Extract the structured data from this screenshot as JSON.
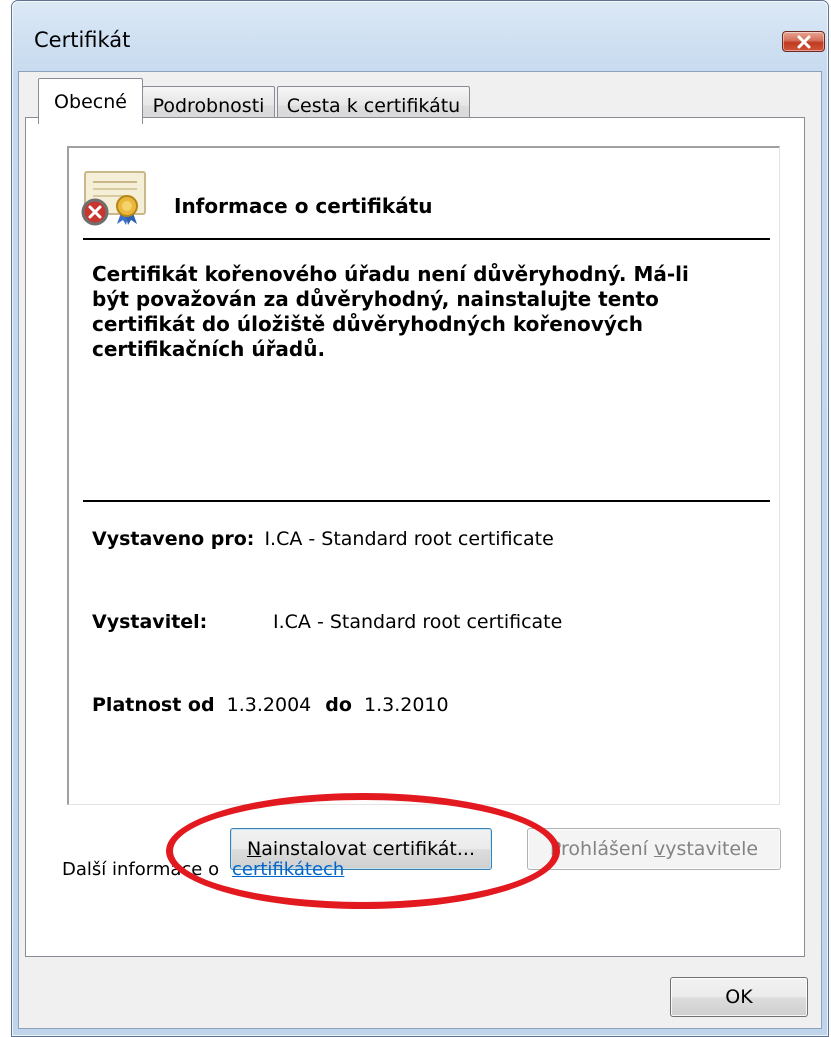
{
  "window": {
    "title": "Certifikát"
  },
  "tabs": [
    {
      "label": "Obecné",
      "active": true
    },
    {
      "label": "Podrobnosti",
      "active": false
    },
    {
      "label": "Cesta k certifikátu",
      "active": false
    }
  ],
  "info": {
    "heading": "Informace o certifikátu",
    "message_lines": [
      "Certifikát kořenového úřadu není důvěryhodný. Má-li",
      "být považován za důvěryhodný, nainstalujte tento",
      "certifikát do úložiště důvěryhodných kořenových",
      "certifikačních úřadů."
    ],
    "issued_to_label": "Vystaveno pro:",
    "issued_to_value": "I.CA - Standard root certificate",
    "issuer_label": "Vystavitel:",
    "issuer_value": "I.CA - Standard root certificate",
    "valid_from_label": "Platnost od",
    "valid_from_value": "1.3.2004",
    "valid_to_label": "do",
    "valid_to_value": "1.3.2010"
  },
  "buttons": {
    "install": {
      "prefix": "",
      "mnemonic": "N",
      "rest": "ainstalovat certifikát..."
    },
    "issuer_statement": {
      "prefix": "Prohlášení ",
      "mnemonic": "v",
      "rest": "ystavitele",
      "disabled": true
    },
    "ok": "OK"
  },
  "more_info": {
    "label": "Další informace o",
    "link": "certifikátech"
  },
  "colors": {
    "highlight": "#e2191f",
    "link": "#0066cc",
    "close_button": "#c03b20"
  },
  "icons": {
    "close": "close-x-icon",
    "certificate": "certificate-error-icon"
  }
}
